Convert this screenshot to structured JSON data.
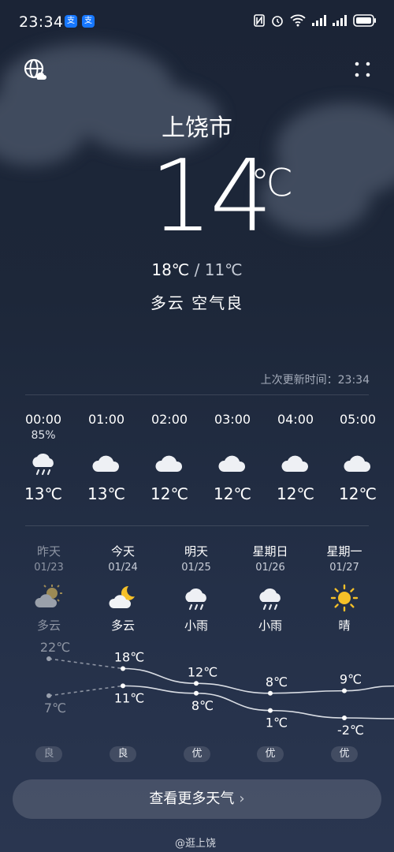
{
  "status_bar": {
    "time": "23:34",
    "app_badges": [
      "支",
      "支"
    ],
    "icons": [
      "nfc-icon",
      "alarm-icon",
      "wifi-icon",
      "signal-icon",
      "signal-icon",
      "battery-icon"
    ]
  },
  "header": {
    "left_icon": "globe-icon",
    "right_icon": "more-dots-icon"
  },
  "current": {
    "city": "上饶市",
    "temperature": "14",
    "unit": "℃",
    "high": "18℃",
    "separator": " / ",
    "low": "11℃",
    "condition": "多云",
    "air": "空气良"
  },
  "updated": "上次更新时间：23:34",
  "hourly": [
    {
      "time": "00:00",
      "prob": "85%",
      "icon": "rain-cloud-icon",
      "temp": "13℃"
    },
    {
      "time": "01:00",
      "prob": "",
      "icon": "cloud-icon",
      "temp": "13℃"
    },
    {
      "time": "02:00",
      "prob": "",
      "icon": "cloud-icon",
      "temp": "12℃"
    },
    {
      "time": "03:00",
      "prob": "",
      "icon": "cloud-icon",
      "temp": "12℃"
    },
    {
      "time": "04:00",
      "prob": "",
      "icon": "cloud-icon",
      "temp": "12℃"
    },
    {
      "time": "05:00",
      "prob": "",
      "icon": "cloud-icon",
      "temp": "12℃"
    }
  ],
  "daily": [
    {
      "name": "昨天",
      "date": "01/23",
      "icon": "partly-cloudy-day-icon",
      "cond": "多云",
      "high": "22℃",
      "low": "7℃",
      "aq": "良"
    },
    {
      "name": "今天",
      "date": "01/24",
      "icon": "partly-cloudy-night-icon",
      "cond": "多云",
      "high": "18℃",
      "low": "11℃",
      "aq": "良"
    },
    {
      "name": "明天",
      "date": "01/25",
      "icon": "rain-cloud-icon",
      "cond": "小雨",
      "high": "12℃",
      "low": "8℃",
      "aq": "优"
    },
    {
      "name": "星期日",
      "date": "01/26",
      "icon": "rain-cloud-icon",
      "cond": "小雨",
      "high": "8℃",
      "low": "1℃",
      "aq": "优"
    },
    {
      "name": "星期一",
      "date": "01/27",
      "icon": "sun-icon",
      "cond": "晴",
      "high": "9℃",
      "low": "-2℃",
      "aq": "优"
    }
  ],
  "more_button": {
    "label": "查看更多天气",
    "chevron": "›"
  },
  "watermark": "@逛上饶",
  "colors": {
    "sun": "#f5c028",
    "cloud": "#f0f2f5",
    "rain": "#e6e9ee",
    "past": "#8e95a3"
  }
}
